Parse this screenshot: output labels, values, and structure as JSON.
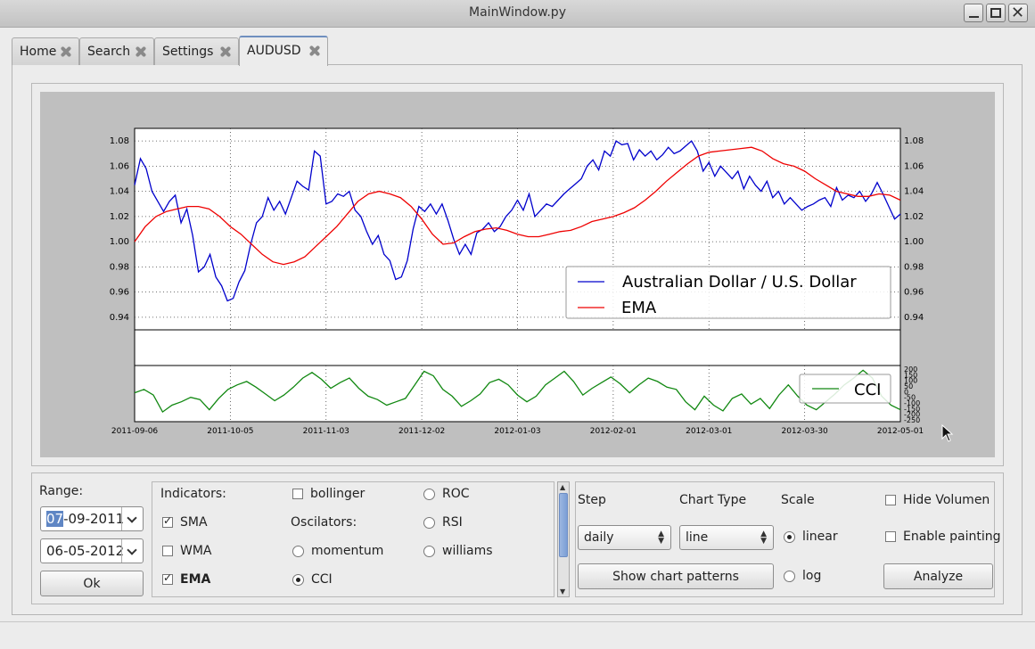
{
  "window": {
    "title": "MainWindow.py"
  },
  "tabs": [
    {
      "label": "Home"
    },
    {
      "label": "Search"
    },
    {
      "label": "Settings"
    },
    {
      "label": "AUDUSD"
    }
  ],
  "chart_data": {
    "type": "line",
    "x_tick_labels": [
      "2011-09-06",
      "2011-10-05",
      "2011-11-03",
      "2011-12-02",
      "2012-01-03",
      "2012-02-01",
      "2012-03-01",
      "2012-03-30",
      "2012-05-01"
    ],
    "y_tick_labels": [
      "0.94",
      "0.96",
      "0.98",
      "1.00",
      "1.02",
      "1.04",
      "1.06",
      "1.08"
    ],
    "ylim": [
      0.93,
      1.09
    ],
    "legend": {
      "placement": "lower-right"
    },
    "grid": true,
    "series": [
      {
        "name": "Australian Dollar / U.S. Dollar",
        "color": "#0000cc",
        "values": [
          1.045,
          1.066,
          1.058,
          1.04,
          1.032,
          1.024,
          1.032,
          1.037,
          1.015,
          1.026,
          1.005,
          0.976,
          0.98,
          0.99,
          0.972,
          0.965,
          0.953,
          0.955,
          0.968,
          0.977,
          0.998,
          1.015,
          1.02,
          1.035,
          1.025,
          1.032,
          1.022,
          1.035,
          1.048,
          1.044,
          1.041,
          1.072,
          1.068,
          1.03,
          1.032,
          1.038,
          1.036,
          1.04,
          1.025,
          1.02,
          1.008,
          0.998,
          1.005,
          0.99,
          0.985,
          0.97,
          0.972,
          0.985,
          1.01,
          1.028,
          1.024,
          1.03,
          1.022,
          1.03,
          1.017,
          1.002,
          0.99,
          0.998,
          0.99,
          1.007,
          1.01,
          1.015,
          1.008,
          1.012,
          1.02,
          1.025,
          1.033,
          1.025,
          1.038,
          1.02,
          1.025,
          1.03,
          1.028,
          1.033,
          1.038,
          1.042,
          1.046,
          1.05,
          1.06,
          1.065,
          1.057,
          1.072,
          1.068,
          1.08,
          1.077,
          1.078,
          1.065,
          1.073,
          1.068,
          1.072,
          1.065,
          1.069,
          1.075,
          1.07,
          1.072,
          1.076,
          1.08,
          1.072,
          1.056,
          1.063,
          1.052,
          1.06,
          1.055,
          1.05,
          1.056,
          1.042,
          1.052,
          1.045,
          1.04,
          1.048,
          1.035,
          1.04,
          1.03,
          1.035,
          1.03,
          1.025,
          1.028,
          1.03,
          1.033,
          1.035,
          1.028,
          1.043,
          1.033,
          1.037,
          1.035,
          1.04,
          1.032,
          1.038,
          1.047,
          1.038,
          1.028,
          1.018,
          1.022
        ]
      },
      {
        "name": "EMA",
        "color": "#ee0000",
        "values": [
          1.0,
          1.012,
          1.02,
          1.024,
          1.026,
          1.028,
          1.028,
          1.026,
          1.02,
          1.012,
          1.006,
          0.998,
          0.99,
          0.984,
          0.982,
          0.984,
          0.988,
          0.996,
          1.004,
          1.012,
          1.022,
          1.032,
          1.038,
          1.04,
          1.038,
          1.035,
          1.028,
          1.018,
          1.006,
          0.998,
          0.999,
          1.004,
          1.008,
          1.01,
          1.011,
          1.009,
          1.006,
          1.004,
          1.004,
          1.006,
          1.008,
          1.009,
          1.012,
          1.016,
          1.018,
          1.02,
          1.023,
          1.027,
          1.033,
          1.04,
          1.048,
          1.055,
          1.062,
          1.068,
          1.071,
          1.072,
          1.073,
          1.074,
          1.075,
          1.072,
          1.066,
          1.062,
          1.06,
          1.056,
          1.05,
          1.045,
          1.04,
          1.038,
          1.036,
          1.036,
          1.038,
          1.037,
          1.033
        ]
      },
      {
        "name": "CCI",
        "color": "#118811",
        "values": [
          -10,
          20,
          -30,
          -180,
          -120,
          -90,
          -50,
          -70,
          -160,
          -60,
          20,
          60,
          90,
          40,
          -20,
          -80,
          -30,
          40,
          120,
          170,
          110,
          30,
          80,
          120,
          30,
          -40,
          -70,
          -120,
          -90,
          -60,
          60,
          180,
          140,
          20,
          -40,
          -130,
          -80,
          -20,
          80,
          110,
          60,
          -30,
          -90,
          -40,
          60,
          120,
          180,
          90,
          -30,
          30,
          80,
          130,
          70,
          -10,
          60,
          120,
          90,
          40,
          20,
          -90,
          -160,
          -40,
          -120,
          -170,
          -60,
          -20,
          -110,
          -60,
          -150,
          -30,
          60,
          -40,
          -120,
          -160,
          -90,
          -20,
          60,
          120,
          190,
          120,
          -40,
          -120,
          -160
        ]
      }
    ],
    "cci_tick_labels": [
      "200",
      "150",
      "100",
      "50",
      "0",
      "-50",
      "-100",
      "-150",
      "-200",
      "-250"
    ]
  },
  "controls": {
    "range_label": "Range:",
    "date_start_sel": "07",
    "date_start_rest": "-09-2011",
    "date_end": "06-05-2012",
    "ok_label": "Ok",
    "indicators_label": "Indicators:",
    "sma_label": "SMA",
    "wma_label": "WMA",
    "ema_label": "EMA",
    "bollinger_label": "bollinger",
    "oscilators_label": "Oscilators:",
    "momentum_label": "momentum",
    "cci_label": "CCI",
    "roc_label": "ROC",
    "rsi_label": "RSI",
    "williams_label": "williams",
    "step_label": "Step",
    "step_value": "daily",
    "charttype_label": "Chart Type",
    "charttype_value": "line",
    "scale_label": "Scale",
    "linear_label": "linear",
    "log_label": "log",
    "hide_volumen_label": "Hide Volumen",
    "enable_painting_label": "Enable painting",
    "patterns_label": "Show chart patterns",
    "analyze_label": "Analyze"
  }
}
